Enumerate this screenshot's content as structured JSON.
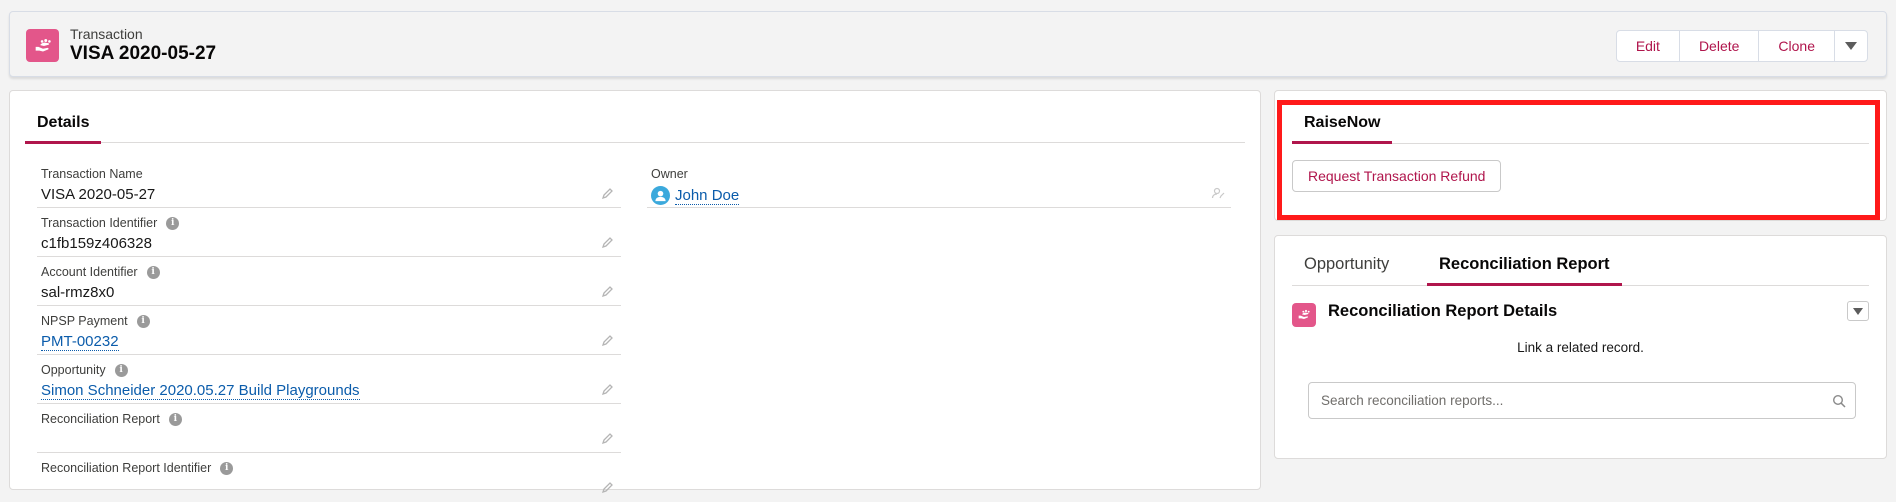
{
  "header": {
    "object_label": "Transaction",
    "record_title": "VISA 2020-05-27",
    "icon": "hand-heart-icon",
    "actions": [
      "Edit",
      "Delete",
      "Clone"
    ],
    "more_icon": "chevron-down-icon"
  },
  "details": {
    "tab_label": "Details",
    "fields": [
      {
        "label": "Transaction Name",
        "value": "VISA 2020-05-27",
        "is_link": false,
        "has_info": false
      },
      {
        "label": "Transaction Identifier",
        "value": "c1fb159z406328",
        "is_link": false,
        "has_info": true
      },
      {
        "label": "Account Identifier",
        "value": "sal-rmz8x0",
        "is_link": false,
        "has_info": true
      },
      {
        "label": "NPSP Payment",
        "value": "PMT-00232",
        "is_link": true,
        "has_info": true
      },
      {
        "label": "Opportunity",
        "value": "Simon Schneider 2020.05.27 Build Playgrounds",
        "is_link": true,
        "has_info": true
      },
      {
        "label": "Reconciliation Report",
        "value": "",
        "is_link": false,
        "has_info": true
      },
      {
        "label": "Reconciliation Report Identifier",
        "value": "",
        "is_link": false,
        "has_info": true
      }
    ],
    "owner": {
      "label": "Owner",
      "value": "John Doe",
      "icon": "user-avatar-icon"
    }
  },
  "raisenow": {
    "tab_label": "RaiseNow",
    "refund_button": "Request Transaction Refund"
  },
  "related": {
    "tabs": [
      {
        "label": "Opportunity",
        "active": false
      },
      {
        "label": "Reconciliation Report",
        "active": true
      }
    ],
    "card_title": "Reconciliation Report Details",
    "hint": "Link a related record.",
    "search_placeholder": "Search reconciliation reports..."
  },
  "colors": {
    "accent": "#b0154c",
    "icon_pink": "#e3568a",
    "link": "#0b5cab",
    "highlight": "#ff1a1a"
  }
}
